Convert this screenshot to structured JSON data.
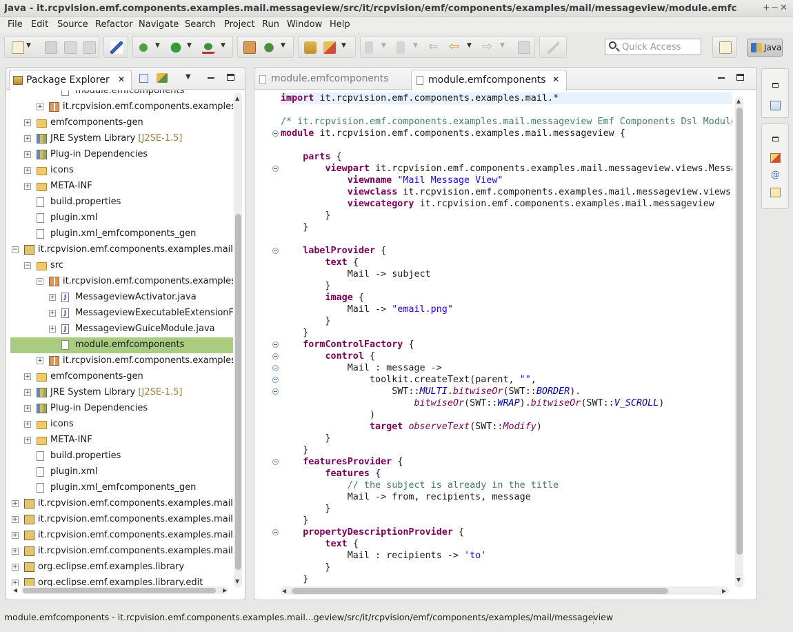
{
  "window": {
    "title": "Java - it.rcpvision.emf.components.examples.mail.messageview/src/it/rcpvision/emf/components/examples/mail/messageview/module.emfc",
    "controls": [
      "+",
      "−",
      "✕"
    ]
  },
  "menu": [
    "File",
    "Edit",
    "Source",
    "Refactor",
    "Navigate",
    "Search",
    "Project",
    "Run",
    "Window",
    "Help"
  ],
  "toolbar": {
    "quick_access_placeholder": "Quick Access",
    "perspective_label": "Java"
  },
  "package_explorer": {
    "tab_label": "Package Explorer",
    "close_glyph": "✕",
    "rows": [
      {
        "label": "module.emfcomponents",
        "indent": 3,
        "icon": "file-icon",
        "twisty": ""
      },
      {
        "label": "it.rcpvision.emf.components.examples.m",
        "indent": 2,
        "icon": "package-icon",
        "twisty": "+"
      },
      {
        "label": "emfcomponents-gen",
        "indent": 1,
        "icon": "folder-icon",
        "twisty": "+"
      },
      {
        "label": "JRE System Library",
        "deco": " [J2SE-1.5]",
        "indent": 1,
        "icon": "library-icon",
        "twisty": "+"
      },
      {
        "label": "Plug-in Dependencies",
        "indent": 1,
        "icon": "library-icon",
        "twisty": "+"
      },
      {
        "label": "icons",
        "indent": 1,
        "icon": "folder-icon",
        "twisty": "+"
      },
      {
        "label": "META-INF",
        "indent": 1,
        "icon": "folder-icon",
        "twisty": "+"
      },
      {
        "label": "build.properties",
        "indent": 1,
        "icon": "file-icon",
        "twisty": ""
      },
      {
        "label": "plugin.xml",
        "indent": 1,
        "icon": "file-icon",
        "twisty": ""
      },
      {
        "label": "plugin.xml_emfcomponents_gen",
        "indent": 1,
        "icon": "file-icon",
        "twisty": ""
      },
      {
        "label": "it.rcpvision.emf.components.examples.mail.me",
        "indent": 0,
        "icon": "project-icon",
        "twisty": "−"
      },
      {
        "label": "src",
        "indent": 1,
        "icon": "folder-icon",
        "twisty": "−"
      },
      {
        "label": "it.rcpvision.emf.components.examples.m",
        "indent": 2,
        "icon": "package-icon",
        "twisty": "−"
      },
      {
        "label": "MessageviewActivator.java",
        "indent": 3,
        "icon": "java-icon",
        "twisty": "+"
      },
      {
        "label": "MessageviewExecutableExtensionFact",
        "indent": 3,
        "icon": "java-icon",
        "twisty": "+"
      },
      {
        "label": "MessageviewGuiceModule.java",
        "indent": 3,
        "icon": "java-icon",
        "twisty": "+"
      },
      {
        "label": "module.emfcomponents",
        "indent": 3,
        "icon": "file-icon",
        "twisty": "",
        "selected": true
      },
      {
        "label": "it.rcpvision.emf.components.examples.m",
        "indent": 2,
        "icon": "package-icon",
        "twisty": "+"
      },
      {
        "label": "emfcomponents-gen",
        "indent": 1,
        "icon": "folder-icon",
        "twisty": "+"
      },
      {
        "label": "JRE System Library",
        "deco": " [J2SE-1.5]",
        "indent": 1,
        "icon": "library-icon",
        "twisty": "+"
      },
      {
        "label": "Plug-in Dependencies",
        "indent": 1,
        "icon": "library-icon",
        "twisty": "+"
      },
      {
        "label": "icons",
        "indent": 1,
        "icon": "folder-icon",
        "twisty": "+"
      },
      {
        "label": "META-INF",
        "indent": 1,
        "icon": "folder-icon",
        "twisty": "+"
      },
      {
        "label": "build.properties",
        "indent": 1,
        "icon": "file-icon",
        "twisty": ""
      },
      {
        "label": "plugin.xml",
        "indent": 1,
        "icon": "file-icon",
        "twisty": ""
      },
      {
        "label": "plugin.xml_emfcomponents_gen",
        "indent": 1,
        "icon": "file-icon",
        "twisty": ""
      },
      {
        "label": "it.rcpvision.emf.components.examples.mail.mo",
        "indent": 0,
        "icon": "project-icon",
        "twisty": "+"
      },
      {
        "label": "it.rcpvision.emf.components.examples.mail.pro",
        "indent": 0,
        "icon": "project-icon",
        "twisty": "+"
      },
      {
        "label": "it.rcpvision.emf.components.examples.mail.pro",
        "indent": 0,
        "icon": "project-icon",
        "twisty": "+"
      },
      {
        "label": "it.rcpvision.emf.components.examples.mail.rcp",
        "indent": 0,
        "icon": "project-icon",
        "twisty": "+"
      },
      {
        "label": "org.eclipse.emf.examples.library",
        "indent": 0,
        "icon": "project-icon",
        "twisty": "+"
      },
      {
        "label": "org.eclipse.emf.examples.library.edit",
        "indent": 0,
        "icon": "project-icon",
        "twisty": "+"
      }
    ]
  },
  "editor": {
    "tabs": [
      "module.emfcomponents",
      "module.emfcomponents"
    ],
    "close_glyph": "✕",
    "lines": [
      [
        [
          "kw",
          "import "
        ],
        [
          "",
          "it.rcpvision.emf.components.examples.mail.*"
        ]
      ],
      [],
      [
        [
          "cm",
          "/* it.rcpvision.emf.components.examples.mail.messageview Emf Components Dsl Module"
        ]
      ],
      [
        [
          "kw",
          "module "
        ],
        [
          "",
          "it.rcpvision.emf.components.examples.mail.messageview {"
        ]
      ],
      [],
      [
        [
          "",
          "    "
        ],
        [
          "kw",
          "parts "
        ],
        [
          "",
          "{"
        ]
      ],
      [
        [
          "",
          "        "
        ],
        [
          "kw",
          "viewpart "
        ],
        [
          "",
          "it.rcpvision.emf.components.examples.mail.messageview.views.Messa"
        ]
      ],
      [
        [
          "",
          "            "
        ],
        [
          "kw",
          "viewname "
        ],
        [
          "st",
          "\"Mail Message View\""
        ]
      ],
      [
        [
          "",
          "            "
        ],
        [
          "kw",
          "viewclass "
        ],
        [
          "",
          "it.rcpvision.emf.components.examples.mail.messageview.views."
        ]
      ],
      [
        [
          "",
          "            "
        ],
        [
          "kw",
          "viewcategory "
        ],
        [
          "",
          "it.rcpvision.emf.components.examples.mail.messageview"
        ]
      ],
      [
        [
          "",
          "        }"
        ]
      ],
      [
        [
          "",
          "    }"
        ]
      ],
      [],
      [
        [
          "",
          "    "
        ],
        [
          "kw",
          "labelProvider "
        ],
        [
          "",
          "{"
        ]
      ],
      [
        [
          "",
          "        "
        ],
        [
          "kw",
          "text "
        ],
        [
          "",
          "{"
        ]
      ],
      [
        [
          "",
          "            Mail -> subject"
        ]
      ],
      [
        [
          "",
          "        }"
        ]
      ],
      [
        [
          "",
          "        "
        ],
        [
          "kw",
          "image "
        ],
        [
          "",
          "{"
        ]
      ],
      [
        [
          "",
          "            Mail -> "
        ],
        [
          "st",
          "\"email.png\""
        ]
      ],
      [
        [
          "",
          "        }"
        ]
      ],
      [
        [
          "",
          "    }"
        ]
      ],
      [
        [
          "",
          "    "
        ],
        [
          "kw",
          "formControlFactory "
        ],
        [
          "",
          "{"
        ]
      ],
      [
        [
          "",
          "        "
        ],
        [
          "kw",
          "control "
        ],
        [
          "",
          "{"
        ]
      ],
      [
        [
          "",
          "            Mail : message ->"
        ]
      ],
      [
        [
          "",
          "                toolkit.createText(parent, "
        ],
        [
          "st",
          "\"\""
        ],
        [
          "",
          ","
        ]
      ],
      [
        [
          "",
          "                    SWT::"
        ],
        [
          "sf",
          "MULTI"
        ],
        [
          "",
          "."
        ],
        [
          "it",
          "bitwiseOr"
        ],
        [
          "",
          "(SWT::"
        ],
        [
          "sf",
          "BORDER"
        ],
        [
          "",
          ")."
        ]
      ],
      [
        [
          "",
          "                        "
        ],
        [
          "it",
          "bitwiseOr"
        ],
        [
          "",
          "(SWT::"
        ],
        [
          "sf",
          "WRAP"
        ],
        [
          "",
          ")."
        ],
        [
          "it",
          "bitwiseOr"
        ],
        [
          "",
          "(SWT::"
        ],
        [
          "sf",
          "V_SCROLL"
        ],
        [
          "",
          ")"
        ]
      ],
      [
        [
          "",
          "                )"
        ]
      ],
      [
        [
          "",
          "                "
        ],
        [
          "kw",
          "target "
        ],
        [
          "it",
          "observeText"
        ],
        [
          "",
          "(SWT::"
        ],
        [
          "it",
          "Modify"
        ],
        [
          "",
          ")"
        ]
      ],
      [
        [
          "",
          "        }"
        ]
      ],
      [
        [
          "",
          "    }"
        ]
      ],
      [
        [
          "",
          "    "
        ],
        [
          "kw",
          "featuresProvider "
        ],
        [
          "",
          "{"
        ]
      ],
      [
        [
          "",
          "        "
        ],
        [
          "kw",
          "features "
        ],
        [
          "",
          "{"
        ]
      ],
      [
        [
          "",
          "            "
        ],
        [
          "cm",
          "// the subject is already in the title"
        ]
      ],
      [
        [
          "",
          "            Mail -> from, recipients, message"
        ]
      ],
      [
        [
          "",
          "        }"
        ]
      ],
      [
        [
          "",
          "    }"
        ]
      ],
      [
        [
          "",
          "    "
        ],
        [
          "kw",
          "propertyDescriptionProvider "
        ],
        [
          "",
          "{"
        ]
      ],
      [
        [
          "",
          "        "
        ],
        [
          "kw",
          "text "
        ],
        [
          "",
          "{"
        ]
      ],
      [
        [
          "",
          "            Mail : recipients -> "
        ],
        [
          "st",
          "'to'"
        ]
      ],
      [
        [
          "",
          "        }"
        ]
      ],
      [
        [
          "",
          "    }"
        ]
      ]
    ]
  },
  "status_bar": {
    "text": "module.emfcomponents - it.rcpvision.emf.components.examples.mail...geview/src/it/rcpvision/emf/components/examples/mail/messageview"
  }
}
